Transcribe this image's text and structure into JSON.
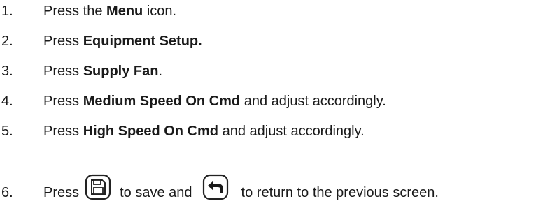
{
  "steps": [
    {
      "number": "1.",
      "pre": "Press the ",
      "bold": "Menu",
      "post": " icon."
    },
    {
      "number": "2.",
      "pre": "Press ",
      "bold": "Equipment Setup.",
      "post": ""
    },
    {
      "number": "3.",
      "pre": "Press ",
      "bold": "Supply Fan",
      "post": "."
    },
    {
      "number": "4.",
      "pre": "Press ",
      "bold": "Medium Speed On Cmd",
      "post": " and adjust accordingly."
    },
    {
      "number": "5.",
      "pre": "Press ",
      "bold": "High Speed On Cmd",
      "post": " and adjust accordingly."
    }
  ],
  "step6": {
    "number": "6.",
    "press": "Press",
    "save_text": "to save and",
    "back_text": "to return to the previous screen.",
    "save_icon": "save-icon",
    "back_icon": "back-arrow-icon"
  }
}
